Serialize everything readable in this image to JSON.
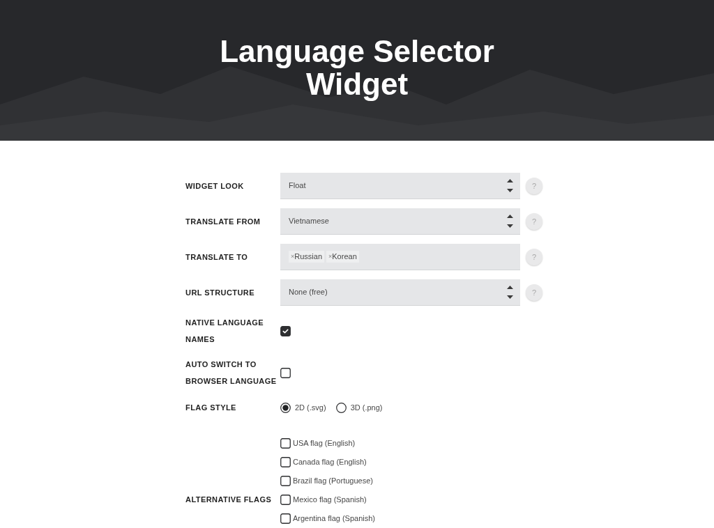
{
  "header": {
    "title": "Language Selector Widget"
  },
  "fields": [
    {
      "kind": "select",
      "label": "WIDGET LOOK",
      "value": "Float",
      "help": "?"
    },
    {
      "kind": "select",
      "label": "TRANSLATE FROM",
      "value": "Vietnamese",
      "help": "?"
    },
    {
      "kind": "tags",
      "label": "TRANSLATE TO",
      "tags": [
        {
          "remove": "×",
          "text": "Russian"
        },
        {
          "remove": "×",
          "text": "Korean"
        }
      ],
      "help": "?"
    },
    {
      "kind": "select",
      "label": "URL STRUCTURE",
      "value": "None (free)",
      "help": "?"
    },
    {
      "kind": "checkbox",
      "label": "NATIVE LANGUAGE NAMES",
      "checked": true
    },
    {
      "kind": "checkbox",
      "label": "AUTO SWITCH TO BROWSER LANGUAGE",
      "checked": false
    },
    {
      "kind": "radio",
      "label": "FLAG STYLE",
      "options": [
        {
          "label": "2D (.svg)",
          "selected": true
        },
        {
          "label": "3D (.png)",
          "selected": false
        }
      ]
    },
    {
      "kind": "checklist",
      "label": "ALTERNATIVE FLAGS",
      "options": [
        {
          "label": "USA flag (English)",
          "checked": false
        },
        {
          "label": "Canada flag (English)",
          "checked": false
        },
        {
          "label": "Brazil flag (Portuguese)",
          "checked": false
        },
        {
          "label": "Mexico flag (Spanish)",
          "checked": false
        },
        {
          "label": "Argentina flag (Spanish)",
          "checked": false
        }
      ]
    }
  ]
}
